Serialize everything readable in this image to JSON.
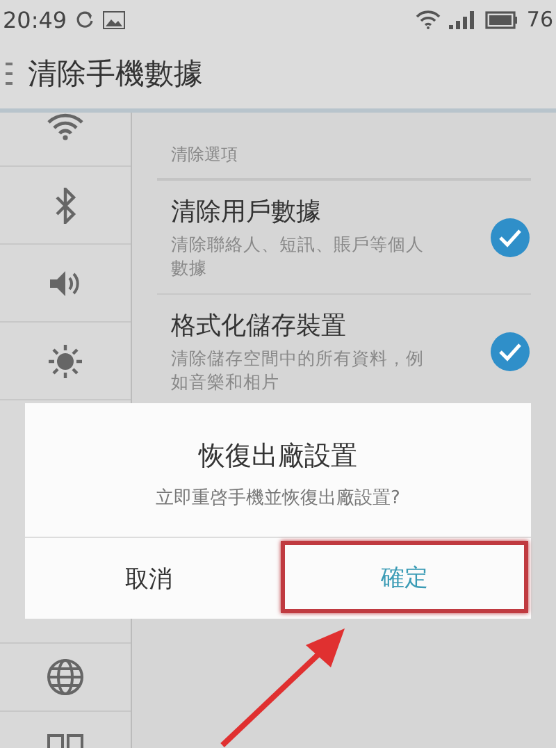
{
  "status_bar": {
    "time": "20:49",
    "battery": "76"
  },
  "header": {
    "title": "清除手機數據"
  },
  "content": {
    "section_label": "清除選項",
    "options": [
      {
        "title": "清除用戶數據",
        "description": "清除聯絡人、短訊、賬戶等個人數據",
        "checked": true
      },
      {
        "title": "格式化儲存裝置",
        "description": "清除儲存空間中的所有資料，例如音樂和相片",
        "checked": true
      }
    ]
  },
  "dialog": {
    "title": "恢復出廠設置",
    "message": "立即重啓手機並恢復出廠設置?",
    "buttons": [
      {
        "label": "取消",
        "kind": "cancel",
        "highlighted": false
      },
      {
        "label": "確定",
        "kind": "confirm",
        "highlighted": true
      }
    ]
  }
}
